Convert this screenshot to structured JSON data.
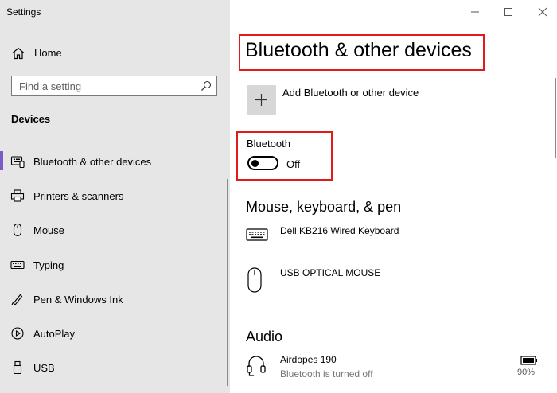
{
  "window": {
    "app_title": "Settings",
    "controls": [
      "minimize-icon",
      "maximize-icon",
      "close-icon"
    ]
  },
  "sidebar": {
    "home_label": "Home",
    "search_placeholder": "Find a setting",
    "section_title": "Devices",
    "items": [
      {
        "label": "Bluetooth & other devices",
        "icon": "bluetooth-devices-icon",
        "selected": true
      },
      {
        "label": "Printers & scanners",
        "icon": "printer-icon",
        "selected": false
      },
      {
        "label": "Mouse",
        "icon": "mouse-icon",
        "selected": false
      },
      {
        "label": "Typing",
        "icon": "keyboard-icon",
        "selected": false
      },
      {
        "label": "Pen & Windows Ink",
        "icon": "pen-icon",
        "selected": false
      },
      {
        "label": "AutoPlay",
        "icon": "autoplay-icon",
        "selected": false
      },
      {
        "label": "USB",
        "icon": "usb-icon",
        "selected": false
      }
    ],
    "accent_color": "#7a5cc7"
  },
  "main": {
    "title": "Bluetooth & other devices",
    "add_device_label": "Add Bluetooth or other device",
    "bluetooth": {
      "label": "Bluetooth",
      "state": "Off",
      "on": false
    },
    "sections": {
      "input": {
        "title": "Mouse, keyboard, & pen",
        "devices": [
          {
            "name": "Dell KB216 Wired Keyboard",
            "icon": "keyboard-icon"
          },
          {
            "name": "USB OPTICAL MOUSE",
            "icon": "mouse-icon"
          }
        ]
      },
      "audio": {
        "title": "Audio",
        "devices": [
          {
            "name": "Airdopes 190",
            "status": "Bluetooth is turned off",
            "icon": "headset-icon",
            "battery": "90%"
          }
        ]
      }
    },
    "highlight_color": "#e01b1b"
  }
}
